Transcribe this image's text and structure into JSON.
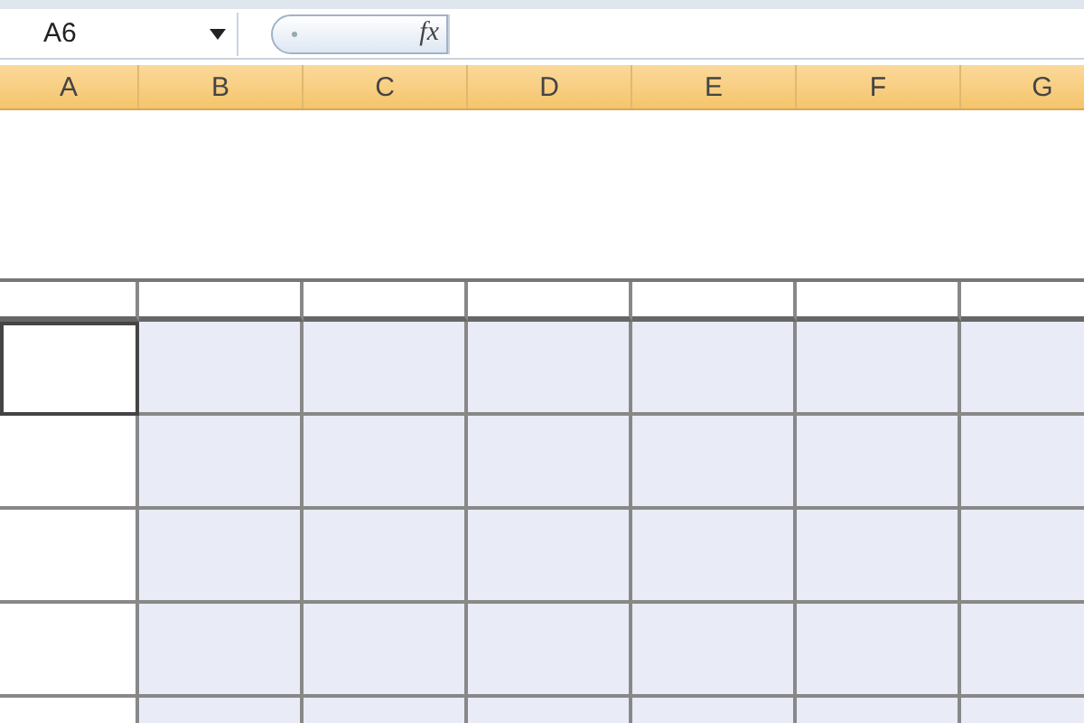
{
  "formula_bar": {
    "name_box": "A6",
    "fx": "fx"
  },
  "columns": [
    {
      "label": "A"
    },
    {
      "label": "B"
    },
    {
      "label": "C"
    },
    {
      "label": "D"
    },
    {
      "label": "E"
    },
    {
      "label": "F"
    },
    {
      "label": "G"
    }
  ],
  "grid": {
    "rows": [
      {
        "cells": [
          {
            "selected": false,
            "shaded": false
          },
          {
            "selected": false,
            "shaded": false
          },
          {
            "selected": false,
            "shaded": false
          },
          {
            "selected": false,
            "shaded": false
          },
          {
            "selected": false,
            "shaded": false
          },
          {
            "selected": false,
            "shaded": false
          },
          {
            "selected": false,
            "shaded": false
          }
        ]
      },
      {
        "cells": [
          {
            "selected": true,
            "shaded": false
          },
          {
            "selected": false,
            "shaded": true
          },
          {
            "selected": false,
            "shaded": true
          },
          {
            "selected": false,
            "shaded": true
          },
          {
            "selected": false,
            "shaded": true
          },
          {
            "selected": false,
            "shaded": true
          },
          {
            "selected": false,
            "shaded": true
          }
        ]
      },
      {
        "cells": [
          {
            "selected": false,
            "shaded": false
          },
          {
            "selected": false,
            "shaded": true
          },
          {
            "selected": false,
            "shaded": true
          },
          {
            "selected": false,
            "shaded": true
          },
          {
            "selected": false,
            "shaded": true
          },
          {
            "selected": false,
            "shaded": true
          },
          {
            "selected": false,
            "shaded": true
          }
        ]
      },
      {
        "cells": [
          {
            "selected": false,
            "shaded": false
          },
          {
            "selected": false,
            "shaded": true
          },
          {
            "selected": false,
            "shaded": true
          },
          {
            "selected": false,
            "shaded": true
          },
          {
            "selected": false,
            "shaded": true
          },
          {
            "selected": false,
            "shaded": true
          },
          {
            "selected": false,
            "shaded": true
          }
        ]
      },
      {
        "cells": [
          {
            "selected": false,
            "shaded": false
          },
          {
            "selected": false,
            "shaded": true
          },
          {
            "selected": false,
            "shaded": true
          },
          {
            "selected": false,
            "shaded": true
          },
          {
            "selected": false,
            "shaded": true
          },
          {
            "selected": false,
            "shaded": true
          },
          {
            "selected": false,
            "shaded": true
          }
        ]
      },
      {
        "cells": [
          {
            "selected": false,
            "shaded": false
          },
          {
            "selected": false,
            "shaded": true
          },
          {
            "selected": false,
            "shaded": true
          },
          {
            "selected": false,
            "shaded": true
          },
          {
            "selected": false,
            "shaded": true
          },
          {
            "selected": false,
            "shaded": true
          },
          {
            "selected": false,
            "shaded": true
          }
        ]
      }
    ]
  }
}
